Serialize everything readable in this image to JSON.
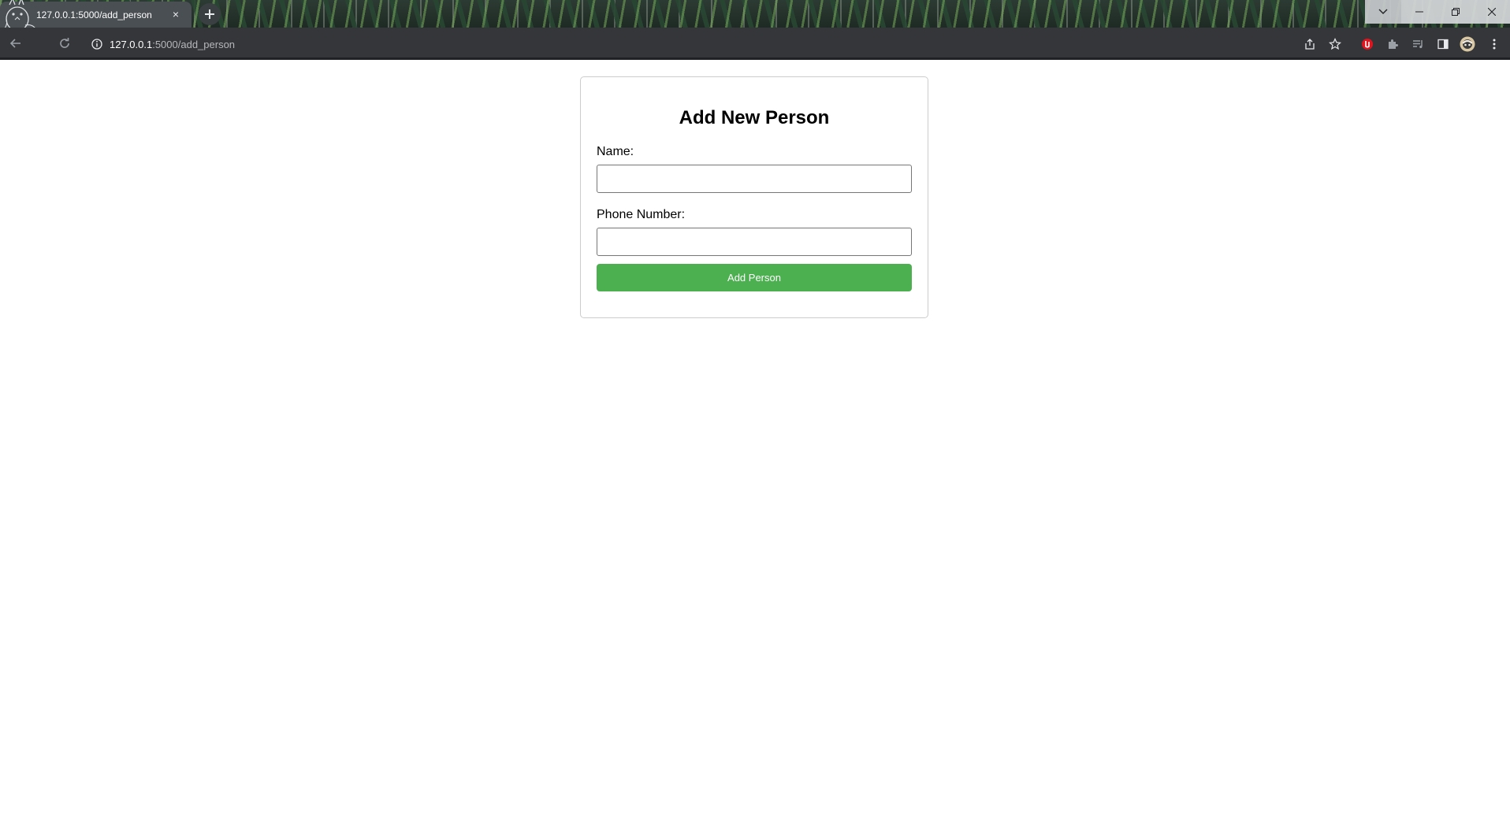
{
  "browser": {
    "tab_title": "127.0.0.1:5000/add_person",
    "tab_close_symbol": "×",
    "url_host": "127.0.0.1",
    "url_path": ":5000/add_person",
    "icons": [
      "back-icon",
      "reload-icon",
      "site-info-icon",
      "share-icon",
      "bookmark-star-icon",
      "extension-red-icon",
      "extensions-puzzle-icon",
      "media-queue-icon",
      "side-panel-icon",
      "profile-avatar",
      "kebab-menu-icon",
      "tab-search-icon",
      "minimize-icon",
      "restore-icon",
      "close-window-icon"
    ]
  },
  "form": {
    "title": "Add New Person",
    "name_label": "Name:",
    "name_value": "",
    "phone_label": "Phone Number:",
    "phone_value": "",
    "submit_label": "Add Person"
  },
  "colors": {
    "button_bg": "#4caf50",
    "toolbar_bg": "#35363a",
    "card_border": "#cccccc"
  }
}
